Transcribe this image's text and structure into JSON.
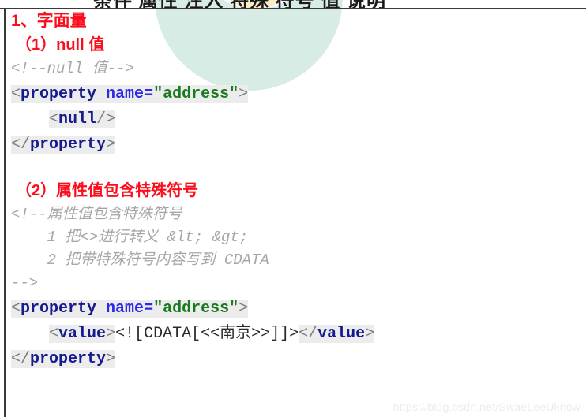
{
  "slide": {
    "top_partial_row": "条件  属性  注入  特殊  符号  值  说明",
    "watermark": "https://blog.csdn.net/SwaeLeeUknow"
  },
  "sections": [
    {
      "heading": "1、字面量",
      "subheading": "（1）null 值",
      "comment_lines": [
        "<!--null 值-->"
      ],
      "code_lines": [
        [
          {
            "text": "<",
            "type": "punct",
            "hl": true
          },
          {
            "text": "property",
            "type": "tag",
            "hl": true
          },
          {
            "text": " ",
            "type": "plain",
            "hl": true
          },
          {
            "text": "name",
            "type": "attr",
            "hl": true
          },
          {
            "text": "=",
            "type": "eq",
            "hl": true
          },
          {
            "text": "\"address\"",
            "type": "value",
            "hl": true
          },
          {
            "text": ">",
            "type": "punct",
            "hl": true
          }
        ],
        [
          {
            "text": "    ",
            "type": "indent",
            "hl": false
          },
          {
            "text": "<",
            "type": "punct",
            "hl": true
          },
          {
            "text": "null",
            "type": "tag",
            "hl": true
          },
          {
            "text": "/>",
            "type": "punct",
            "hl": true
          }
        ],
        [
          {
            "text": "</",
            "type": "punct",
            "hl": true
          },
          {
            "text": "property",
            "type": "tag",
            "hl": true
          },
          {
            "text": ">",
            "type": "punct",
            "hl": true
          }
        ]
      ]
    },
    {
      "heading": null,
      "subheading": "（2）属性值包含特殊符号",
      "comment_lines": [
        "<!--属性值包含特殊符号",
        "    1 把<>进行转义 &lt; &gt;",
        "    2 把带特殊符号内容写到 CDATA",
        "-->"
      ],
      "code_lines": [
        [
          {
            "text": "<",
            "type": "punct",
            "hl": true
          },
          {
            "text": "property",
            "type": "tag",
            "hl": true
          },
          {
            "text": " ",
            "type": "plain",
            "hl": true
          },
          {
            "text": "name",
            "type": "attr",
            "hl": true
          },
          {
            "text": "=",
            "type": "eq",
            "hl": true
          },
          {
            "text": "\"address\"",
            "type": "value",
            "hl": true
          },
          {
            "text": ">",
            "type": "punct",
            "hl": true
          }
        ],
        [
          {
            "text": "    ",
            "type": "indent",
            "hl": false
          },
          {
            "text": "<",
            "type": "punct",
            "hl": true
          },
          {
            "text": "value",
            "type": "tag",
            "hl": true
          },
          {
            "text": ">",
            "type": "punct",
            "hl": true
          },
          {
            "text": "<![CDATA[<<南京>>]]>",
            "type": "plain",
            "hl": false
          },
          {
            "text": "</",
            "type": "punct",
            "hl": true
          },
          {
            "text": "value",
            "type": "tag",
            "hl": true
          },
          {
            "text": ">",
            "type": "punct",
            "hl": true
          }
        ],
        [
          {
            "text": "</",
            "type": "punct",
            "hl": true
          },
          {
            "text": "property",
            "type": "tag",
            "hl": true
          },
          {
            "text": ">",
            "type": "punct",
            "hl": true
          }
        ]
      ]
    }
  ],
  "colors": {
    "heading_red": "#fc0d1c",
    "tag_navy": "#151b8d",
    "attr_blue": "#2a2ae8",
    "value_green": "#1a7a1f",
    "comment_gray": "#a6a6a6",
    "code_highlight": "#ececed",
    "deco_mint": "#d7ece4",
    "deco_cream": "#fbeccb",
    "rule_dark": "#3a3a3a",
    "watermark_gray": "#ececec"
  }
}
